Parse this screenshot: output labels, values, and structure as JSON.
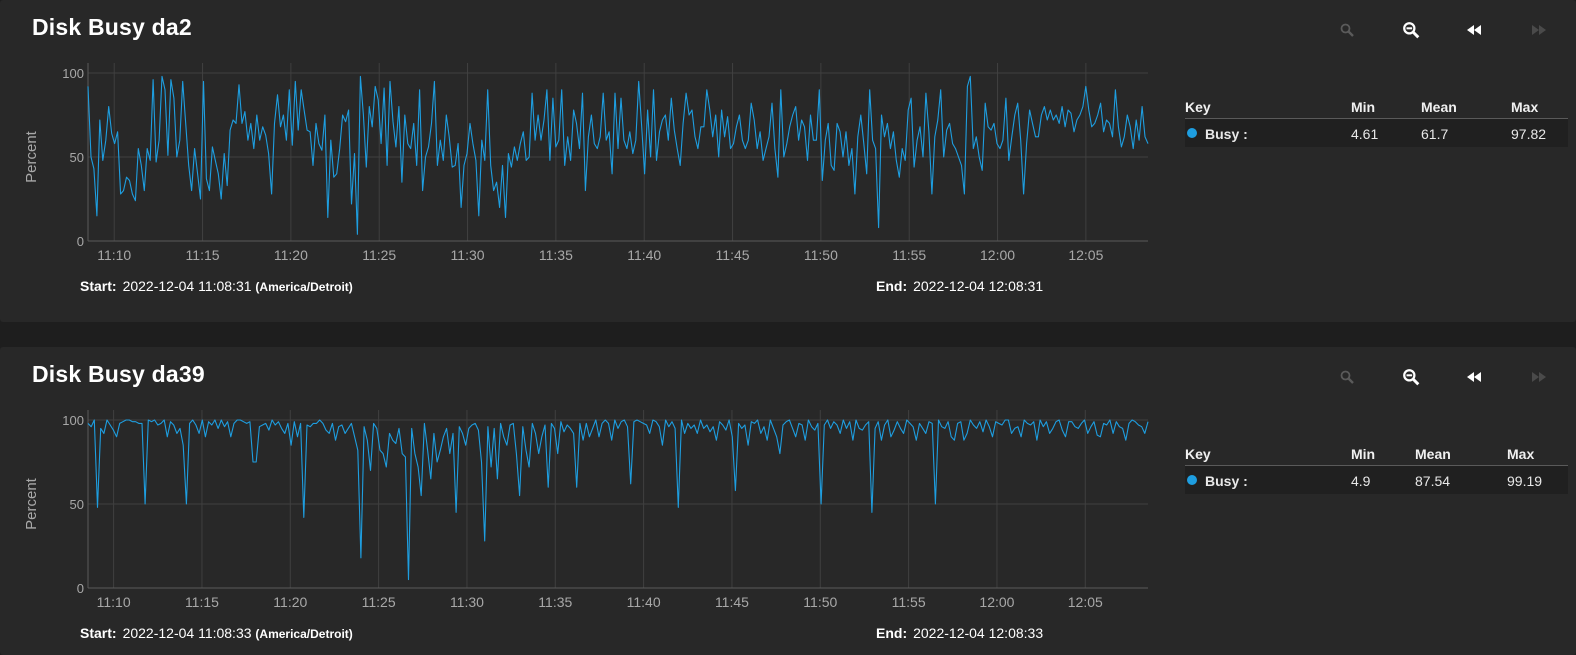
{
  "colors": {
    "series": "#1e9ee0",
    "panel_bg": "#282828",
    "page_bg": "#1e1e1e",
    "grid": "#404040",
    "axis_text": "#a8a8a8"
  },
  "toolbar": [
    {
      "icon": "zoom-in-icon",
      "enabled": false
    },
    {
      "icon": "zoom-out-icon",
      "enabled": true
    },
    {
      "icon": "step-back-icon",
      "enabled": true
    },
    {
      "icon": "step-forward-icon",
      "enabled": false
    }
  ],
  "panels": [
    {
      "title": "Disk Busy da2",
      "start_label": "Start:",
      "start_value": "2022-12-04 11:08:31",
      "timezone": "(America/Detroit)",
      "end_label": "End:",
      "end_value": "2022-12-04 12:08:31",
      "legend": {
        "headers": {
          "key": "Key",
          "min": "Min",
          "mean": "Mean",
          "max": "Max"
        },
        "rows": [
          {
            "name": "Busy :",
            "min": "4.61",
            "mean": "61.7",
            "max": "97.82"
          }
        ]
      }
    },
    {
      "title": "Disk Busy da39",
      "start_label": "Start:",
      "start_value": "2022-12-04 11:08:33",
      "timezone": "(America/Detroit)",
      "end_label": "End:",
      "end_value": "2022-12-04 12:08:33",
      "legend": {
        "headers": {
          "key": "Key",
          "min": "Min",
          "mean": "Mean",
          "max": "Max"
        },
        "rows": [
          {
            "name": "Busy :",
            "min": "4.9",
            "mean": "87.54",
            "max": "99.19"
          }
        ]
      }
    }
  ],
  "chart_data": [
    {
      "type": "line",
      "ylabel": "Percent",
      "ylim": [
        0,
        100
      ],
      "yticks": [
        0,
        50,
        100
      ],
      "xlim": [
        "11:08:31",
        "12:08:31"
      ],
      "xticks": [
        "11:10",
        "11:15",
        "11:20",
        "11:25",
        "11:30",
        "11:35",
        "11:40",
        "11:45",
        "11:50",
        "11:55",
        "12:00",
        "12:05"
      ],
      "grid": true,
      "series": [
        {
          "name": "Busy",
          "x_start": "11:08:31",
          "x_end": "12:08:31",
          "values": [
            92,
            50,
            43,
            15,
            72,
            48,
            60,
            80,
            64,
            58,
            65,
            28,
            30,
            38,
            36,
            28,
            24,
            55,
            45,
            30,
            55,
            48,
            96,
            47,
            60,
            98,
            90,
            51,
            96,
            85,
            50,
            60,
            95,
            70,
            45,
            30,
            55,
            40,
            25,
            95,
            37,
            30,
            56,
            48,
            40,
            25,
            52,
            33,
            66,
            72,
            70,
            93,
            70,
            77,
            60,
            70,
            55,
            75,
            60,
            68,
            63,
            52,
            28,
            70,
            87,
            68,
            75,
            60,
            90,
            57,
            95,
            66,
            90,
            78,
            66,
            65,
            45,
            70,
            58,
            54,
            75,
            14,
            60,
            38,
            40,
            55,
            75,
            71,
            78,
            22,
            52,
            4,
            98,
            75,
            44,
            80,
            68,
            92,
            84,
            58,
            91,
            45,
            95,
            71,
            56,
            80,
            35,
            75,
            58,
            55,
            70,
            45,
            90,
            30,
            50,
            56,
            70,
            95,
            45,
            60,
            48,
            75,
            62,
            44,
            45,
            58,
            20,
            45,
            52,
            70,
            58,
            48,
            15,
            60,
            48,
            90,
            45,
            30,
            35,
            20,
            45,
            14,
            52,
            44,
            56,
            48,
            58,
            65,
            48,
            50,
            88,
            60,
            75,
            60,
            72,
            90,
            48,
            85,
            56,
            60,
            90,
            45,
            62,
            48,
            78,
            70,
            55,
            88,
            30,
            62,
            75,
            58,
            55,
            62,
            88,
            60,
            65,
            40,
            88,
            55,
            85,
            60,
            55,
            65,
            52,
            60,
            95,
            68,
            40,
            78,
            50,
            90,
            48,
            65,
            72,
            75,
            60,
            85,
            66,
            55,
            45,
            70,
            88,
            75,
            78,
            62,
            55,
            68,
            68,
            90,
            78,
            62,
            75,
            50,
            78,
            62,
            74,
            55,
            58,
            68,
            75,
            60,
            55,
            60,
            82,
            72,
            55,
            65,
            48,
            55,
            62,
            82,
            55,
            38,
            90,
            50,
            58,
            68,
            75,
            80,
            60,
            72,
            68,
            48,
            75,
            60,
            60,
            90,
            36,
            60,
            70,
            45,
            42,
            70,
            65,
            50,
            65,
            45,
            55,
            28,
            62,
            75,
            58,
            40,
            90,
            60,
            55,
            8,
            75,
            62,
            70,
            55,
            65,
            48,
            38,
            55,
            48,
            78,
            85,
            44,
            60,
            68,
            50,
            88,
            65,
            28,
            62,
            72,
            90,
            50,
            66,
            70,
            58,
            55,
            50,
            45,
            28,
            92,
            98,
            55,
            62,
            50,
            42,
            82,
            68,
            66,
            70,
            58,
            55,
            60,
            85,
            48,
            62,
            75,
            82,
            60,
            28,
            58,
            78,
            70,
            62,
            62,
            75,
            80,
            72,
            78,
            72,
            75,
            70,
            80,
            68,
            78,
            76,
            65,
            72,
            75,
            80,
            92,
            78,
            68,
            70,
            75,
            82,
            65,
            72,
            70,
            62,
            90,
            68,
            56,
            62,
            75,
            68,
            55,
            72,
            60,
            80,
            62,
            58
          ]
        }
      ]
    },
    {
      "type": "line",
      "ylabel": "Percent",
      "ylim": [
        0,
        100
      ],
      "yticks": [
        0,
        50,
        100
      ],
      "xlim": [
        "11:08:33",
        "12:08:33"
      ],
      "xticks": [
        "11:10",
        "11:15",
        "11:20",
        "11:25",
        "11:30",
        "11:35",
        "11:40",
        "11:45",
        "11:50",
        "11:55",
        "12:00",
        "12:05"
      ],
      "grid": true,
      "series": [
        {
          "name": "Busy",
          "x_start": "11:08:33",
          "x_end": "12:08:33",
          "values": [
            98,
            96,
            100,
            48,
            95,
            92,
            100,
            97,
            94,
            90,
            98,
            99,
            100,
            100,
            99,
            99,
            98,
            98,
            50,
            100,
            99,
            100,
            97,
            98,
            100,
            90,
            99,
            97,
            92,
            95,
            85,
            50,
            98,
            100,
            97,
            92,
            100,
            90,
            99,
            97,
            100,
            95,
            100,
            96,
            99,
            90,
            98,
            100,
            100,
            99,
            98,
            99,
            75,
            75,
            96,
            97,
            98,
            94,
            100,
            97,
            99,
            95,
            92,
            98,
            85,
            99,
            90,
            98,
            42,
            97,
            96,
            98,
            98,
            100,
            98,
            94,
            92,
            98,
            88,
            96,
            97,
            92,
            95,
            98,
            90,
            82,
            18,
            96,
            88,
            70,
            98,
            95,
            82,
            80,
            72,
            92,
            88,
            86,
            95,
            80,
            78,
            5,
            95,
            80,
            72,
            55,
            98,
            82,
            65,
            92,
            75,
            82,
            90,
            95,
            80,
            92,
            45,
            96,
            92,
            85,
            95,
            97,
            98,
            94,
            75,
            28,
            96,
            72,
            95,
            65,
            98,
            90,
            85,
            97,
            98,
            80,
            55,
            96,
            82,
            72,
            98,
            92,
            80,
            90,
            97,
            60,
            98,
            95,
            80,
            99,
            93,
            97,
            95,
            92,
            60,
            98,
            88,
            98,
            90,
            95,
            100,
            90,
            98,
            100,
            98,
            88,
            100,
            95,
            99,
            100,
            96,
            62,
            99,
            100,
            99,
            98,
            97,
            92,
            100,
            99,
            96,
            85,
            100,
            96,
            99,
            95,
            48,
            100,
            92,
            98,
            95,
            97,
            92,
            100,
            95,
            97,
            93,
            96,
            88,
            99,
            97,
            94,
            100,
            90,
            58,
            98,
            95,
            97,
            85,
            99,
            98,
            100,
            92,
            96,
            88,
            100,
            95,
            90,
            80,
            97,
            99,
            100,
            95,
            90,
            98,
            97,
            88,
            100,
            96,
            94,
            98,
            50,
            97,
            100,
            95,
            99,
            97,
            92,
            100,
            95,
            99,
            88,
            100,
            95,
            94,
            97,
            99,
            45,
            95,
            99,
            88,
            97,
            100,
            90,
            94,
            99,
            95,
            92,
            100,
            98,
            96,
            88,
            98,
            95,
            92,
            99,
            98,
            50,
            100,
            96,
            95,
            99,
            90,
            88,
            98,
            99,
            88,
            92,
            100,
            97,
            95,
            99,
            93,
            100,
            96,
            90,
            99,
            98,
            97,
            100,
            100,
            92,
            95,
            96,
            90,
            100,
            98,
            97,
            99,
            88,
            100,
            96,
            99,
            92,
            95,
            99,
            100,
            94,
            90,
            99,
            99,
            96,
            95,
            98,
            100,
            92,
            96,
            99,
            91,
            90,
            98,
            97,
            100,
            92,
            99,
            96,
            95,
            88,
            98,
            100,
            99,
            97,
            96,
            92,
            99
          ]
        }
      ]
    }
  ]
}
